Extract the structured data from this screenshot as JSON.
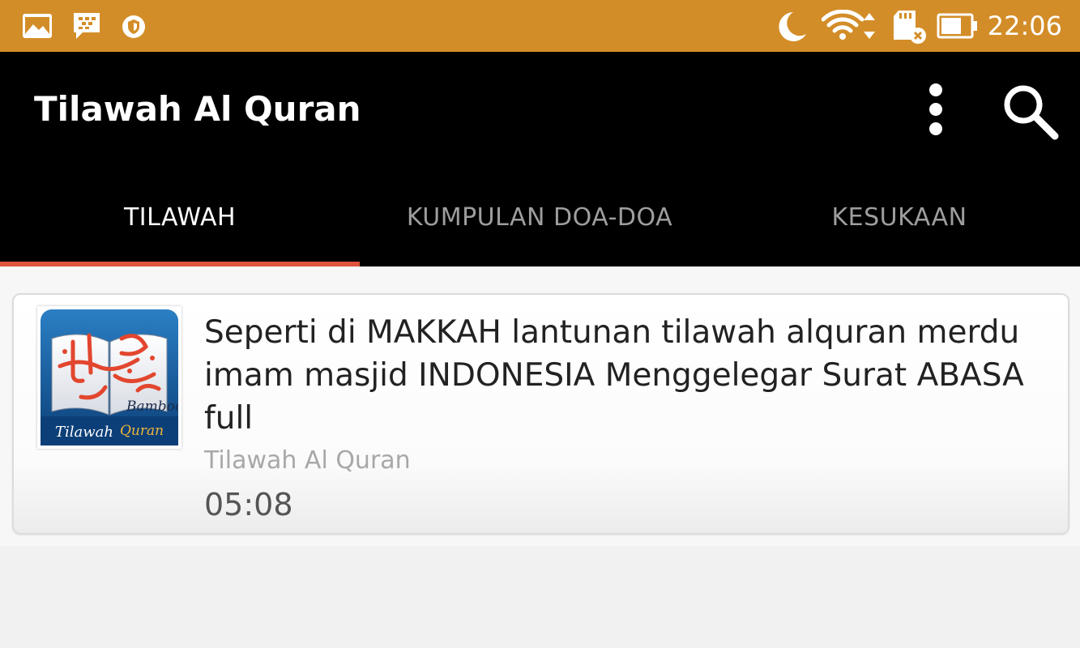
{
  "status_bar": {
    "time": "22:06",
    "icons_left": [
      "gallery-icon",
      "bbm-chat-icon",
      "shield-icon"
    ],
    "icons_right": [
      "moon-icon",
      "wifi-icon",
      "sd-card-icon",
      "battery-icon"
    ],
    "background": "#d38d28"
  },
  "app_bar": {
    "title": "Tilawah Al Quran",
    "actions": [
      "more-vert-icon",
      "search-icon"
    ]
  },
  "tabs": [
    {
      "label": "TILAWAH",
      "active": true
    },
    {
      "label": "KUMPULAN DOA-DOA",
      "active": false
    },
    {
      "label": "KESUKAAN",
      "active": false
    }
  ],
  "accent_color": "#e0533f",
  "videos": [
    {
      "title": "Seperti di MAKKAH lantunan tilawah alquran merdu imam masjid INDONESIA Menggelegar Surat ABASA full",
      "channel": "Tilawah Al Quran",
      "duration": "05:08",
      "thumbnail": {
        "caption": "Tilawah Quran",
        "tag": "Bamboo"
      }
    }
  ]
}
